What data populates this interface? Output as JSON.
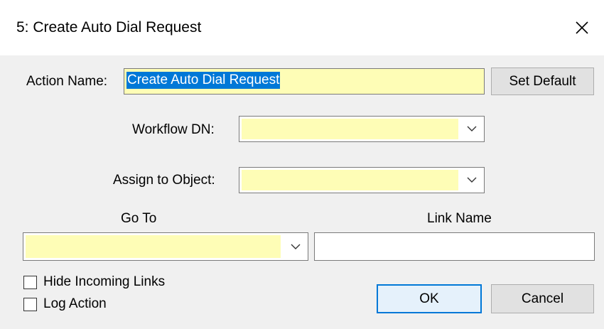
{
  "dialog": {
    "title": "5: Create Auto Dial Request"
  },
  "form": {
    "action_name_label": "Action Name:",
    "action_name_value": "Create Auto Dial Request",
    "set_default_label": "Set Default",
    "workflow_dn_label": "Workflow DN:",
    "workflow_dn_value": "",
    "assign_to_object_label": "Assign to Object:",
    "assign_to_object_value": "",
    "go_to_label": "Go To",
    "go_to_value": "",
    "link_name_label": "Link Name",
    "link_name_value": "",
    "hide_incoming_links_label": "Hide Incoming Links",
    "hide_incoming_links_checked": false,
    "log_action_label": "Log Action",
    "log_action_checked": false
  },
  "buttons": {
    "ok_label": "OK",
    "cancel_label": "Cancel"
  },
  "colors": {
    "required_field_bg": "#fefdb6",
    "selection": "#0078d7",
    "dialog_bg": "#f0f0f0"
  }
}
